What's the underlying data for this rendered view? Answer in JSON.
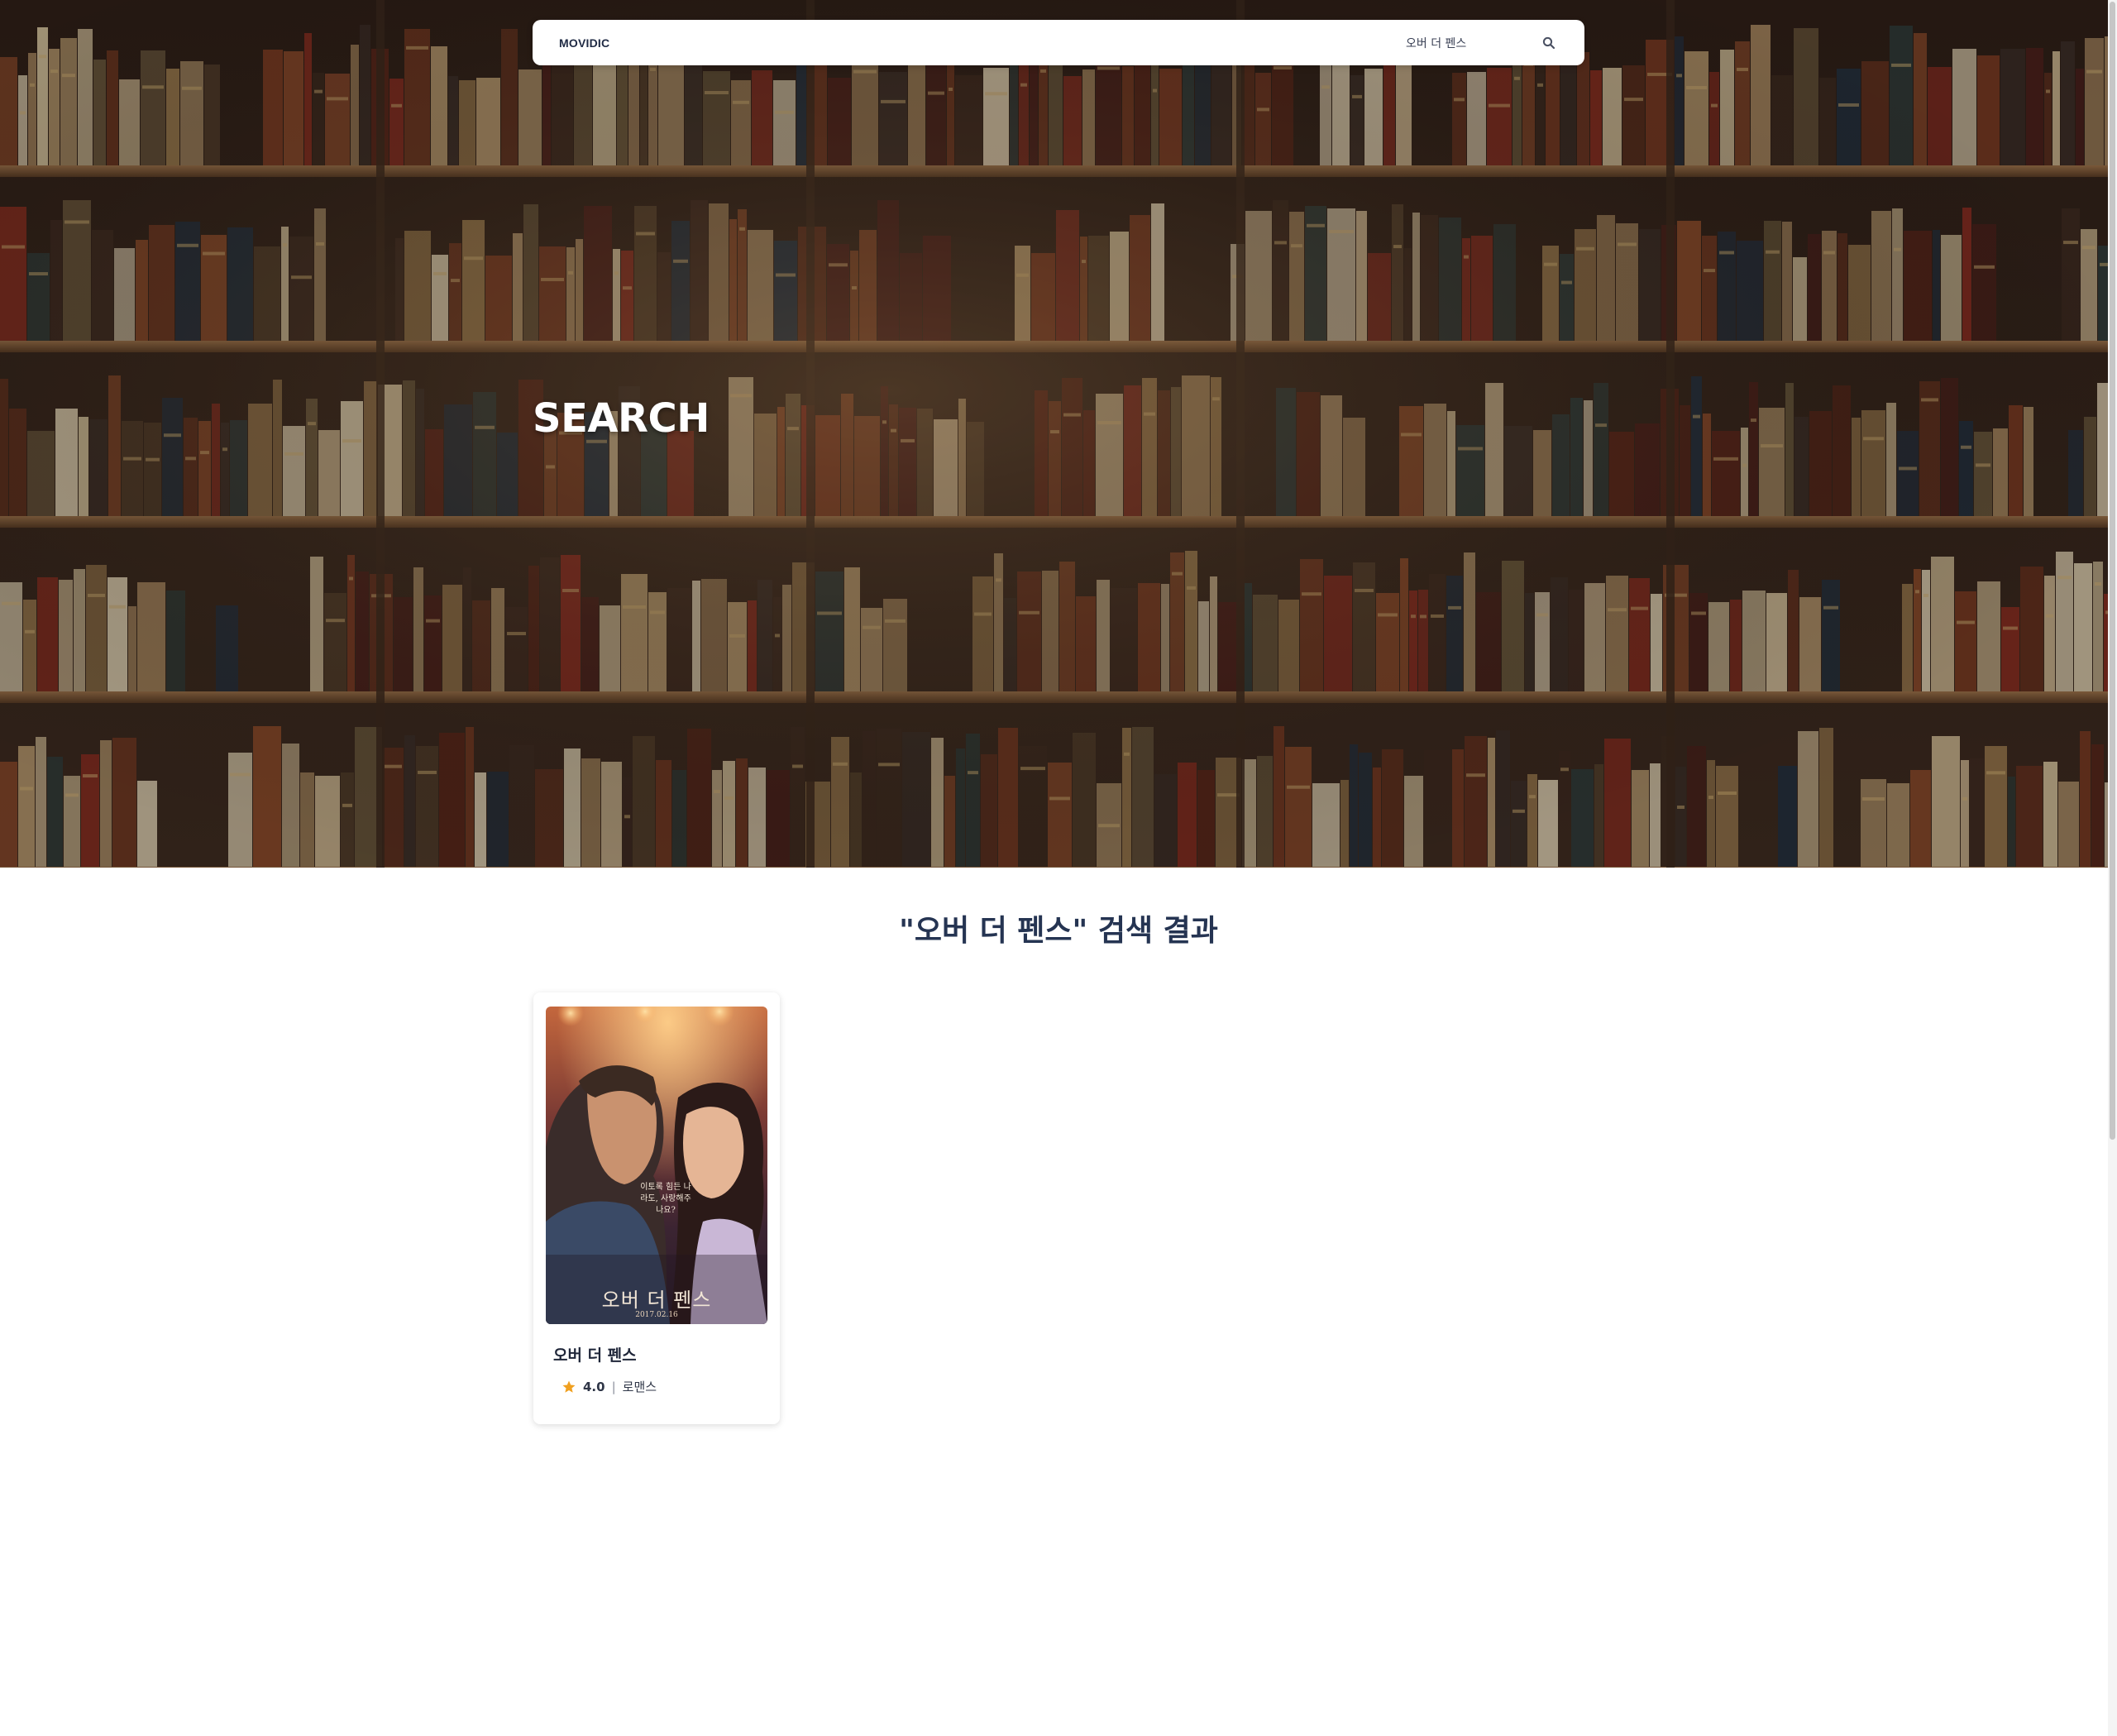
{
  "navbar": {
    "brand": "MOVIDIC",
    "search_value": "오버 더 펜스",
    "search_icon": "search-icon"
  },
  "hero": {
    "title": "SEARCH",
    "background": "bookshelf-photo"
  },
  "results": {
    "heading": "\"오버 더 펜스\" 검색 결과",
    "movies": [
      {
        "title": "오버 더 펜스",
        "rating": "4.0",
        "separator": "|",
        "genre": "로맨스",
        "rating_icon": "star-icon",
        "poster": {
          "title": "오버 더 펜스",
          "date": "2017.02.16",
          "tagline": "이토록 힘든 나라도, 사랑해주나요?"
        }
      }
    ]
  },
  "colors": {
    "heading": "#253452",
    "brand": "#1f2a44",
    "star": "#f0a020",
    "hero_overlay": "#140e0a"
  }
}
